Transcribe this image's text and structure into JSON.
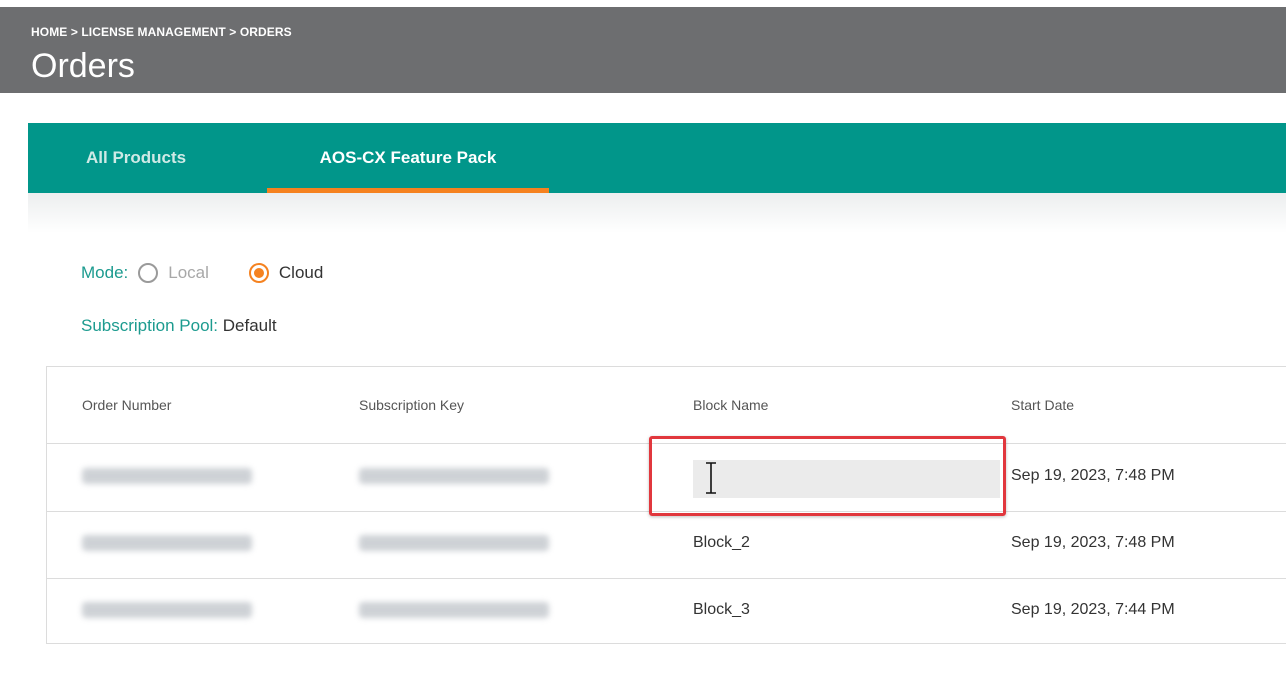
{
  "header": {
    "breadcrumb": "HOME > LICENSE MANAGEMENT > ORDERS",
    "title": "Orders",
    "background_color": "#6d6e70"
  },
  "tabs": [
    {
      "label": "All Products",
      "active": false
    },
    {
      "label": "AOS-CX Feature Pack",
      "active": true
    }
  ],
  "colors": {
    "tabbar": "#01968a",
    "tab_indicator": "#f58220",
    "label_teal": "#1c9b8f",
    "radio_selected": "#f58220",
    "highlight_border": "#e1373d"
  },
  "mode": {
    "label": "Mode:",
    "options": [
      {
        "label": "Local",
        "selected": false
      },
      {
        "label": "Cloud",
        "selected": true
      }
    ]
  },
  "subscription_pool": {
    "label": "Subscription Pool:",
    "value": "Default"
  },
  "table": {
    "columns": [
      "Order Number",
      "Subscription Key",
      "Block Name",
      "Start Date"
    ],
    "rows": [
      {
        "order_number": "",
        "subscription_key": "",
        "block_name": "",
        "start_date": "Sep 19, 2023, 7:48 PM",
        "editing": true
      },
      {
        "order_number": "",
        "subscription_key": "",
        "block_name": "Block_2",
        "start_date": "Sep 19, 2023, 7:48 PM"
      },
      {
        "order_number": "",
        "subscription_key": "",
        "block_name": "Block_3",
        "start_date": "Sep 19, 2023, 7:44 PM"
      }
    ]
  },
  "icons": {
    "text_cursor": "text-cursor-icon"
  }
}
